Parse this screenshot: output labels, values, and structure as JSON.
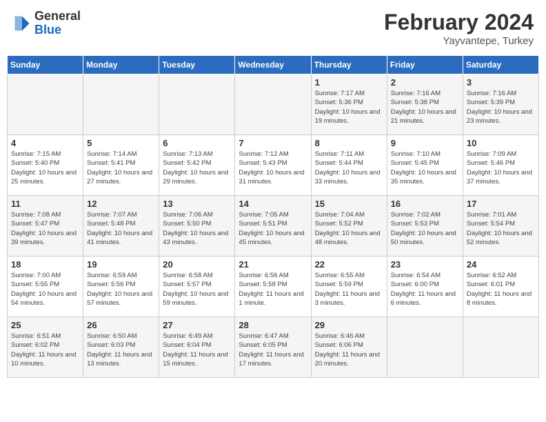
{
  "header": {
    "logo_general": "General",
    "logo_blue": "Blue",
    "main_title": "February 2024",
    "subtitle": "Yayvantepe, Turkey"
  },
  "days_of_week": [
    "Sunday",
    "Monday",
    "Tuesday",
    "Wednesday",
    "Thursday",
    "Friday",
    "Saturday"
  ],
  "weeks": [
    [
      {
        "day": "",
        "info": ""
      },
      {
        "day": "",
        "info": ""
      },
      {
        "day": "",
        "info": ""
      },
      {
        "day": "",
        "info": ""
      },
      {
        "day": "1",
        "info": "Sunrise: 7:17 AM\nSunset: 5:36 PM\nDaylight: 10 hours and 19 minutes."
      },
      {
        "day": "2",
        "info": "Sunrise: 7:16 AM\nSunset: 5:38 PM\nDaylight: 10 hours and 21 minutes."
      },
      {
        "day": "3",
        "info": "Sunrise: 7:16 AM\nSunset: 5:39 PM\nDaylight: 10 hours and 23 minutes."
      }
    ],
    [
      {
        "day": "4",
        "info": "Sunrise: 7:15 AM\nSunset: 5:40 PM\nDaylight: 10 hours and 25 minutes."
      },
      {
        "day": "5",
        "info": "Sunrise: 7:14 AM\nSunset: 5:41 PM\nDaylight: 10 hours and 27 minutes."
      },
      {
        "day": "6",
        "info": "Sunrise: 7:13 AM\nSunset: 5:42 PM\nDaylight: 10 hours and 29 minutes."
      },
      {
        "day": "7",
        "info": "Sunrise: 7:12 AM\nSunset: 5:43 PM\nDaylight: 10 hours and 31 minutes."
      },
      {
        "day": "8",
        "info": "Sunrise: 7:11 AM\nSunset: 5:44 PM\nDaylight: 10 hours and 33 minutes."
      },
      {
        "day": "9",
        "info": "Sunrise: 7:10 AM\nSunset: 5:45 PM\nDaylight: 10 hours and 35 minutes."
      },
      {
        "day": "10",
        "info": "Sunrise: 7:09 AM\nSunset: 5:46 PM\nDaylight: 10 hours and 37 minutes."
      }
    ],
    [
      {
        "day": "11",
        "info": "Sunrise: 7:08 AM\nSunset: 5:47 PM\nDaylight: 10 hours and 39 minutes."
      },
      {
        "day": "12",
        "info": "Sunrise: 7:07 AM\nSunset: 5:48 PM\nDaylight: 10 hours and 41 minutes."
      },
      {
        "day": "13",
        "info": "Sunrise: 7:06 AM\nSunset: 5:50 PM\nDaylight: 10 hours and 43 minutes."
      },
      {
        "day": "14",
        "info": "Sunrise: 7:05 AM\nSunset: 5:51 PM\nDaylight: 10 hours and 45 minutes."
      },
      {
        "day": "15",
        "info": "Sunrise: 7:04 AM\nSunset: 5:52 PM\nDaylight: 10 hours and 48 minutes."
      },
      {
        "day": "16",
        "info": "Sunrise: 7:02 AM\nSunset: 5:53 PM\nDaylight: 10 hours and 50 minutes."
      },
      {
        "day": "17",
        "info": "Sunrise: 7:01 AM\nSunset: 5:54 PM\nDaylight: 10 hours and 52 minutes."
      }
    ],
    [
      {
        "day": "18",
        "info": "Sunrise: 7:00 AM\nSunset: 5:55 PM\nDaylight: 10 hours and 54 minutes."
      },
      {
        "day": "19",
        "info": "Sunrise: 6:59 AM\nSunset: 5:56 PM\nDaylight: 10 hours and 57 minutes."
      },
      {
        "day": "20",
        "info": "Sunrise: 6:58 AM\nSunset: 5:57 PM\nDaylight: 10 hours and 59 minutes."
      },
      {
        "day": "21",
        "info": "Sunrise: 6:56 AM\nSunset: 5:58 PM\nDaylight: 11 hours and 1 minute."
      },
      {
        "day": "22",
        "info": "Sunrise: 6:55 AM\nSunset: 5:59 PM\nDaylight: 11 hours and 3 minutes."
      },
      {
        "day": "23",
        "info": "Sunrise: 6:54 AM\nSunset: 6:00 PM\nDaylight: 11 hours and 6 minutes."
      },
      {
        "day": "24",
        "info": "Sunrise: 6:52 AM\nSunset: 6:01 PM\nDaylight: 11 hours and 8 minutes."
      }
    ],
    [
      {
        "day": "25",
        "info": "Sunrise: 6:51 AM\nSunset: 6:02 PM\nDaylight: 11 hours and 10 minutes."
      },
      {
        "day": "26",
        "info": "Sunrise: 6:50 AM\nSunset: 6:03 PM\nDaylight: 11 hours and 13 minutes."
      },
      {
        "day": "27",
        "info": "Sunrise: 6:49 AM\nSunset: 6:04 PM\nDaylight: 11 hours and 15 minutes."
      },
      {
        "day": "28",
        "info": "Sunrise: 6:47 AM\nSunset: 6:05 PM\nDaylight: 11 hours and 17 minutes."
      },
      {
        "day": "29",
        "info": "Sunrise: 6:46 AM\nSunset: 6:06 PM\nDaylight: 11 hours and 20 minutes."
      },
      {
        "day": "",
        "info": ""
      },
      {
        "day": "",
        "info": ""
      }
    ]
  ]
}
